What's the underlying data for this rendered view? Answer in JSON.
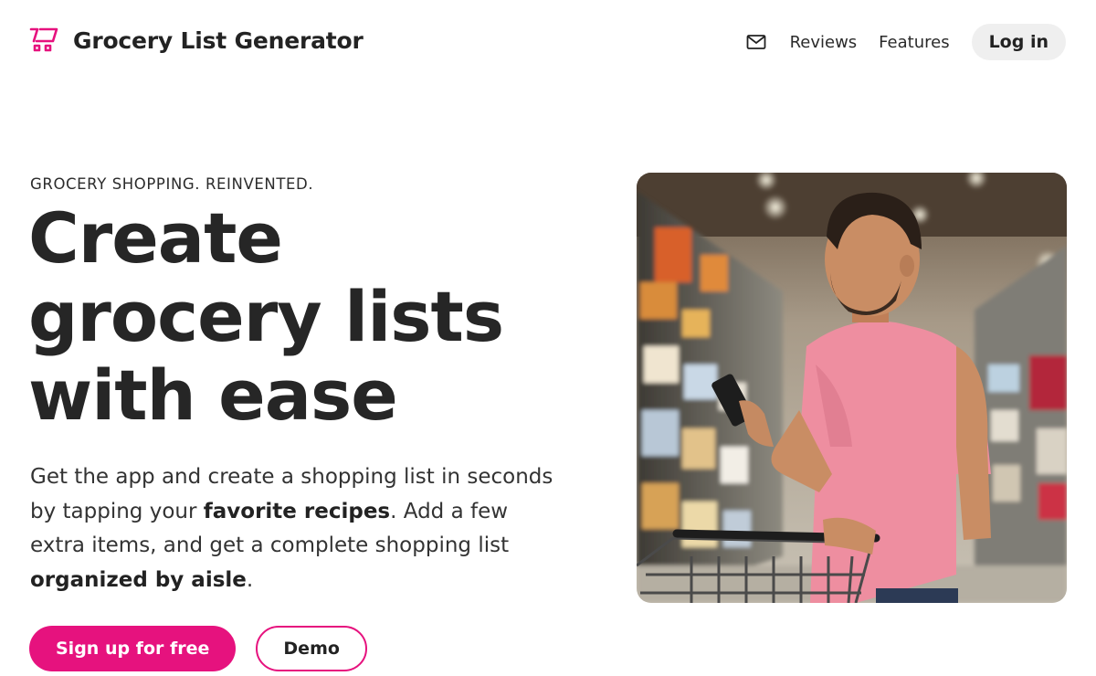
{
  "header": {
    "brand_name": "Grocery List Generator",
    "brand_color": "#e6127e",
    "nav": {
      "mail_icon": "mail-icon",
      "reviews": "Reviews",
      "features": "Features",
      "login": "Log in"
    }
  },
  "hero": {
    "eyebrow": "GROCERY SHOPPING. REINVENTED.",
    "headline": "Create grocery lists with ease",
    "lead": {
      "part1": "Get the app and create a shopping list in seconds by tapping your ",
      "bold1": "favorite recipes",
      "part2": ". Add a few extra items, and get a complete shopping list ",
      "bold2": "organized by aisle",
      "part3": "."
    },
    "cta": {
      "primary": "Sign up for free",
      "secondary": "Demo"
    },
    "image": {
      "description_icon": "shopper-in-grocery-aisle-photo"
    }
  }
}
